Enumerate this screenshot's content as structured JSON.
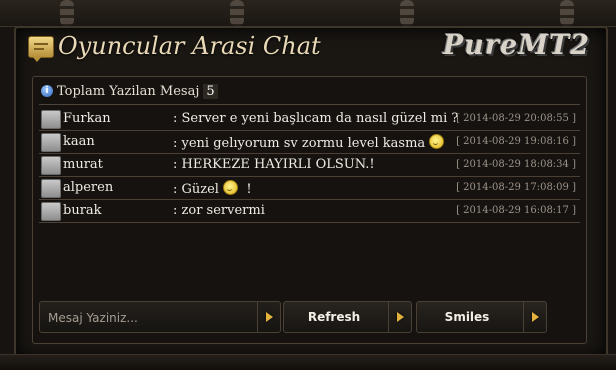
{
  "header": {
    "title": "Oyuncular Arasi Chat",
    "logo_text": "PureMT2"
  },
  "counter": {
    "label": "Toplam Yazilan Mesaj",
    "value": "5"
  },
  "messages": [
    {
      "user": "Furkan",
      "text": ": Server e yeni başlıcam da nasıl güzel mi ?",
      "time": "[ 2014-08-29 20:08:55 ]",
      "smiley": false
    },
    {
      "user": "kaan",
      "text": ": yeni gelıyorum sv zormu level kasma",
      "time": "[ 2014-08-29 19:08:16 ]",
      "smiley": true
    },
    {
      "user": "murat",
      "text": ": HERKEZE HAYIRLI OLSUN.!",
      "time": "[ 2014-08-29 18:08:34 ]",
      "smiley": false
    },
    {
      "user": "alperen",
      "text": ": Güzel",
      "text_after": "!",
      "time": "[ 2014-08-29 17:08:09 ]",
      "smiley": true
    },
    {
      "user": "burak",
      "text": ": zor servermi",
      "time": "[ 2014-08-29 16:08:17 ]",
      "smiley": false
    }
  ],
  "controls": {
    "input_placeholder": "Mesaj Yaziniz...",
    "refresh_label": "Refresh",
    "smiles_label": "Smiles"
  },
  "colors": {
    "background": "#161310",
    "text": "#f0ece4",
    "timestamp": "#9c948a",
    "arrow_accent": "#e2b23c"
  },
  "icons": [
    "chat-bubble-icon",
    "info-icon",
    "avatar-icon",
    "smiley-icon",
    "arrow-right-icon"
  ]
}
